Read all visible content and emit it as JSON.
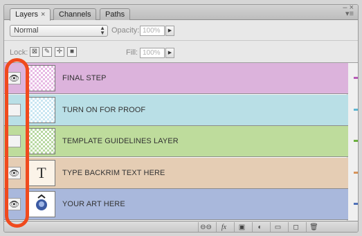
{
  "tabs": [
    {
      "label": "Layers",
      "close": "×",
      "active": true
    },
    {
      "label": "Channels"
    },
    {
      "label": "Paths"
    }
  ],
  "window": {
    "minimize": "–",
    "close": "×",
    "menu": "▾≡"
  },
  "blend": {
    "mode": "Normal",
    "opacity_label": "Opacity:",
    "opacity_value": "100%",
    "arrows": "▲▼"
  },
  "lock": {
    "label": "Lock:",
    "fill_label": "Fill:",
    "fill_value": "100%",
    "icons": [
      "lock-transparent-icon",
      "lock-paint-icon",
      "lock-move-icon",
      "lock-all-icon"
    ]
  },
  "layers": [
    {
      "name": "FINAL STEP",
      "visible": true,
      "color": "#dcb3dc",
      "tick": "#b85cb8",
      "thumb": "checker-pink"
    },
    {
      "name": "TURN ON FOR PROOF",
      "visible": false,
      "color": "#b9dfe6",
      "tick": "#5fb7d2",
      "thumb": "checker-blue"
    },
    {
      "name": "TEMPLATE GUIDELINES LAYER",
      "visible": false,
      "color": "#bedc9c",
      "tick": "#6cb03f",
      "thumb": "checker-green"
    },
    {
      "name": "TYPE BACKRIM TEXT HERE",
      "visible": true,
      "color": "#e5cdb4",
      "tick": "#d7945a",
      "thumb": "T"
    },
    {
      "name": "YOUR ART HERE",
      "visible": true,
      "color": "#a9b8dc",
      "tick": "#5071b8",
      "thumb": "art"
    }
  ],
  "bottom_icons": [
    "link-icon",
    "fx-icon",
    "mask-icon",
    "adjustment-icon",
    "folder-icon",
    "new-layer-icon",
    "trash-icon"
  ],
  "bottom_glyphs": [
    "⊖⊖",
    "fx",
    "▣",
    "◐",
    "▭",
    "◻",
    "🗑"
  ],
  "eye_glyph": "👁",
  "highlight_color": "#f04a1d"
}
